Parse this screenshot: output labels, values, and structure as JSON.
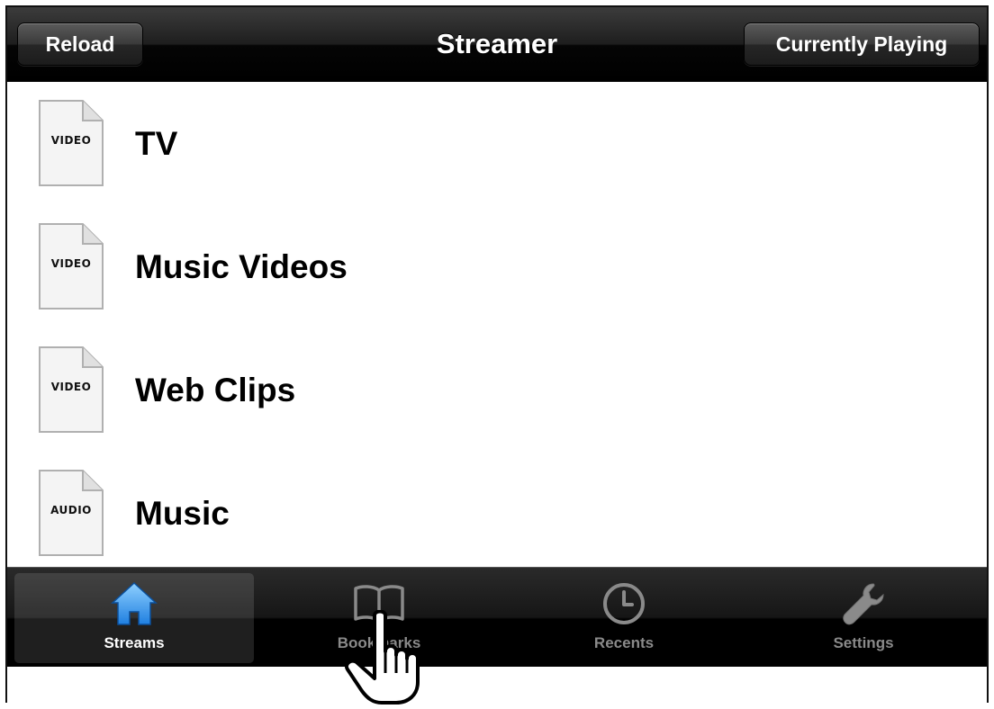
{
  "navbar": {
    "title": "Streamer",
    "left_button": "Reload",
    "right_button": "Currently Playing"
  },
  "streams": [
    {
      "type": "VIDEO",
      "label": "TV"
    },
    {
      "type": "VIDEO",
      "label": "Music Videos"
    },
    {
      "type": "VIDEO",
      "label": "Web Clips"
    },
    {
      "type": "AUDIO",
      "label": "Music"
    }
  ],
  "tabbar": {
    "tabs": [
      {
        "label": "Streams",
        "icon": "house-icon",
        "selected": true
      },
      {
        "label": "Bookmarks",
        "icon": "book-icon",
        "selected": false
      },
      {
        "label": "Recents",
        "icon": "clock-icon",
        "selected": false
      },
      {
        "label": "Settings",
        "icon": "wrench-icon",
        "selected": false
      }
    ]
  },
  "colors": {
    "bar": "#000000",
    "selected_icon": "#3a9bf0",
    "inactive_label": "#8a8a8a"
  }
}
